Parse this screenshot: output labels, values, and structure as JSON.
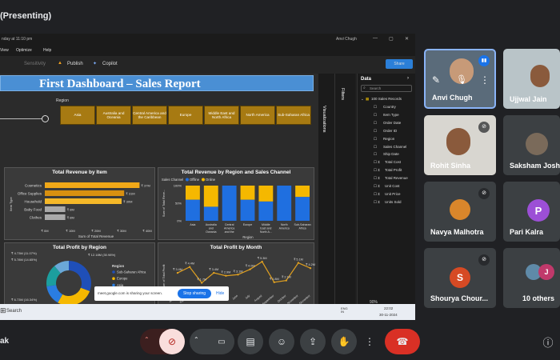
{
  "meet": {
    "presenting_label": "(Presenting)",
    "self_name_partial": "ak",
    "share_notice": "meet.google.com is sharing your screen.",
    "stop_sharing": "Stop sharing",
    "hide": "Hide"
  },
  "powerbi": {
    "title_bar_left": "nday at 11:10 pm",
    "title_user": "Anvi Chugh",
    "menu": [
      "View",
      "Optimize",
      "Help"
    ],
    "toolbar": {
      "sensitivity": "Sensitivity",
      "publish": "Publish",
      "copilot": "Copilot",
      "share": "Share"
    },
    "zoom": "90%",
    "page_tab": "e 2",
    "panes": {
      "visualizations": "Visualizations",
      "filters": "Filters",
      "data": "Data",
      "search_placeholder": "Search"
    },
    "fields": {
      "table": "100 Sales Records",
      "items": [
        "Country",
        "Item Type",
        "Order Date",
        "Order ID",
        "Region",
        "Sales Channel",
        "Ship Date",
        "Total Cost",
        "Total Profit",
        "Total Revenue",
        "Unit Cost",
        "Unit Price",
        "Units Sold"
      ]
    }
  },
  "dashboard": {
    "title": "First Dashboard – Sales Report",
    "slicer_label": "Region",
    "regions": [
      "Asia",
      "Australia and Oceania",
      "Central America and the Caribbean",
      "Europe",
      "Middle East and North Africa",
      "North America",
      "Sub-Saharan Africa"
    ]
  },
  "chart_data": [
    {
      "type": "bar",
      "title": "Total Revenue by Item",
      "orientation": "horizontal",
      "categories": [
        "Cosmetics",
        "Office Supplies",
        "Household",
        "Baby Food",
        "Clothes"
      ],
      "values": [
        37,
        31,
        30,
        8,
        8
      ],
      "value_labels": [
        "₹ 37M",
        "₹ 31M",
        "₹ 30M",
        "₹ 8M",
        "₹ 8M"
      ],
      "xlabel": "Sum of Total Revenue",
      "ylabel": "Item Type",
      "x_ticks": [
        "₹ 0M",
        "₹ 10M",
        "₹ 20M",
        "₹ 30M",
        "₹ 40M"
      ],
      "xlim": [
        0,
        40
      ]
    },
    {
      "type": "bar",
      "title": "Total Revenue by Region and Sales Channel",
      "stacked_percent": true,
      "legend_title": "Sales Channel",
      "categories": [
        "Asia",
        "Australia and Oceania",
        "Central America and the Car...",
        "Europe",
        "Middle East and North A...",
        "North America",
        "Sub-Saharan Africa"
      ],
      "series": [
        {
          "name": "Offline",
          "values": [
            60,
            40,
            100,
            60,
            55,
            100,
            68
          ]
        },
        {
          "name": "Online",
          "values": [
            40,
            60,
            0,
            40,
            45,
            0,
            32
          ]
        }
      ],
      "xlabel": "Region",
      "ylabel": "Sum of Total Reve...",
      "y_ticks": [
        "0%",
        "50%",
        "100%"
      ],
      "colors": {
        "Offline": "#1f6fe0",
        "Online": "#f5b800"
      }
    },
    {
      "type": "pie",
      "donut": true,
      "title": "Total Profit by Region",
      "legend_title": "Region",
      "labels": [
        "Sub-Saharan Africa",
        "Europe",
        "Asia",
        "Middle East and N...",
        "Australia and Oce..."
      ],
      "values": [
        30.98,
        27.5,
        14.65,
        16.34,
        11.07
      ],
      "slice_labels": [
        "₹ 12.18M (30.98%)",
        "₹ 11.08M (27.5%)",
        "₹ 5.78M (14.65%)",
        "₹ 6.73M (16.34%)",
        "₹ 4.73M (11.07%)"
      ],
      "colors": [
        "#1f4fb8",
        "#f5b800",
        "#2a7de1",
        "#1c9e9e",
        "#6aa8d8"
      ]
    },
    {
      "type": "line",
      "title": "Total Profit by Month",
      "x": [
        "January",
        "February",
        "March",
        "April",
        "May",
        "June",
        "July",
        "August",
        "September",
        "October",
        "November",
        "December"
      ],
      "values": [
        3.4,
        4.4,
        1.7,
        3.4,
        2.9,
        3.1,
        4.0,
        5.3,
        1.8,
        2.1,
        5.1,
        4.2
      ],
      "point_labels": [
        "₹ 3.4M",
        "₹ 4.4M",
        "₹ 1.7M",
        "₹ 3.4M",
        "₹ 2.9M",
        "₹ 3.1M",
        "₹ 4.0M",
        "₹ 5.3M",
        "₹ 1.8M",
        "₹ 2.1M",
        "₹ 5.1M",
        "₹ 4.2M"
      ],
      "xlabel": "Month",
      "ylabel": "Sum of Total Profit",
      "ylim": [
        0,
        6
      ],
      "colors": {
        "line": "#e0a020"
      }
    }
  ],
  "taskbar": {
    "search": "Search",
    "lang": "ENG IN",
    "time": "22:02",
    "date": "30-11-2024"
  },
  "participants": [
    {
      "name": "Anvi Chugh",
      "type": "video",
      "speaking": true
    },
    {
      "name": "Ujjwal Jain",
      "type": "video"
    },
    {
      "name": "Rohit Sinha",
      "type": "video",
      "muted": true
    },
    {
      "name": "Saksham Joshi",
      "type": "photo"
    },
    {
      "name": "Navya Malhotra",
      "type": "photo",
      "muted": true
    },
    {
      "name": "Pari Kalra",
      "type": "letter",
      "letter": "P",
      "color": "#9c4fd6"
    },
    {
      "name": "Shourya Chour...",
      "type": "letter",
      "letter": "S",
      "color": "#d64a24",
      "muted": true
    },
    {
      "name": "10 others",
      "type": "group",
      "letter": "J",
      "color": "#c0396b"
    }
  ]
}
